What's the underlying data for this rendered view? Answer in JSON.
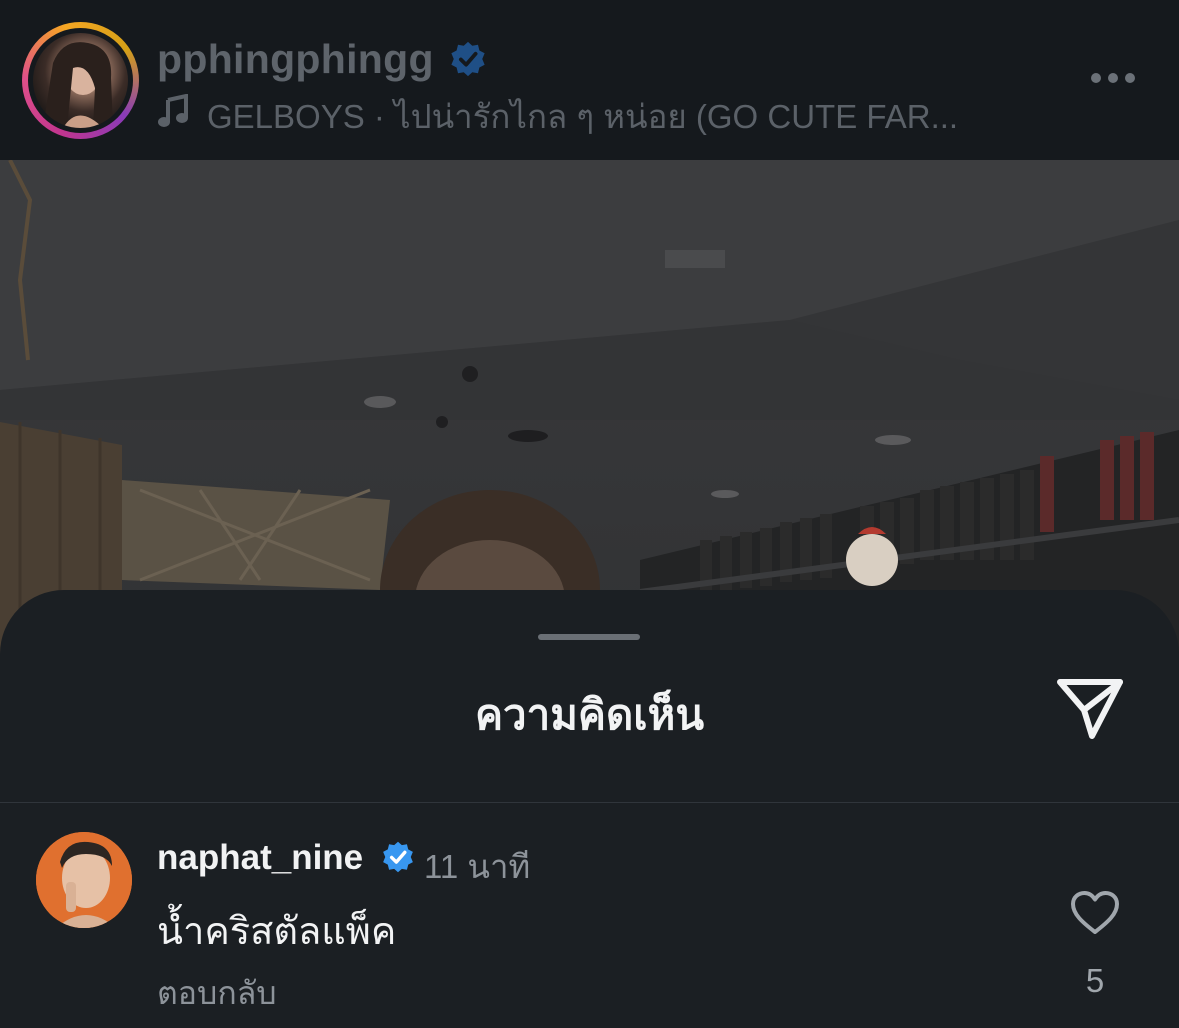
{
  "story": {
    "username": "pphingphingg",
    "music_text": "GELBOYS · ไปน่ารักไกล ๆ หน่อย (GO CUTE FAR...",
    "icons": {
      "music": "music-note-icon",
      "verified": "verified-badge-icon",
      "more": "more-options-icon"
    }
  },
  "comments_sheet": {
    "title": "ความคิดเห็น",
    "share_icon": "share-send-icon"
  },
  "comments": [
    {
      "username": "naphat_nine",
      "time": "11 นาที",
      "text": "น้ำคริสตัลแพ็ค",
      "reply_label": "ตอบกลับ",
      "likes": "5"
    }
  ],
  "colors": {
    "verified_blue": "#3897f0",
    "sheet_bg": "#1b1f23",
    "header_bg": "#15191d"
  }
}
